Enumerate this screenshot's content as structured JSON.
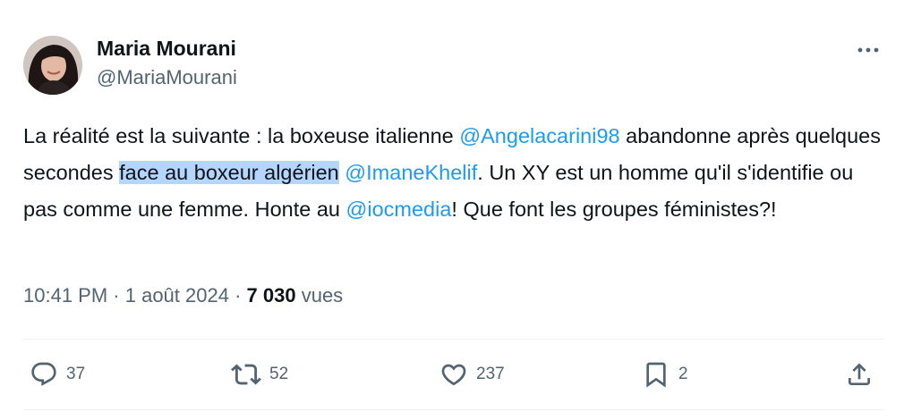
{
  "author": {
    "name": "Maria Mourani",
    "handle": "@MariaMourani"
  },
  "tweet": {
    "text_1": "La réalité est la suivante : la boxeuse italienne ",
    "mention_1": "@Angelacarini98",
    "text_2": " abandonne après quelques secondes ",
    "highlighted": "face au boxeur algérien",
    "text_3": " ",
    "mention_2": "@ImaneKhelif",
    "text_4": ". Un XY est un homme qu'il s'identifie ou pas comme une femme. Honte au ",
    "mention_3": "@iocmedia",
    "text_5": "! Que font les groupes féministes?!"
  },
  "meta": {
    "time": "10:41 PM",
    "separator_1": " · ",
    "date": "1 août 2024",
    "separator_2": " · ",
    "views": "7 030",
    "views_label": " vues"
  },
  "actions": {
    "replies": "37",
    "retweets": "52",
    "likes": "237",
    "bookmarks": "2"
  },
  "icons": {
    "more": "more-horizontal-icon",
    "reply": "reply-icon",
    "retweet": "retweet-icon",
    "like": "heart-icon",
    "bookmark": "bookmark-icon",
    "share": "share-icon"
  },
  "colors": {
    "text": "#0f1419",
    "secondary": "#536471",
    "link": "#1d9bf0",
    "highlight": "#b4d5fe",
    "divider": "#eff3f4"
  }
}
